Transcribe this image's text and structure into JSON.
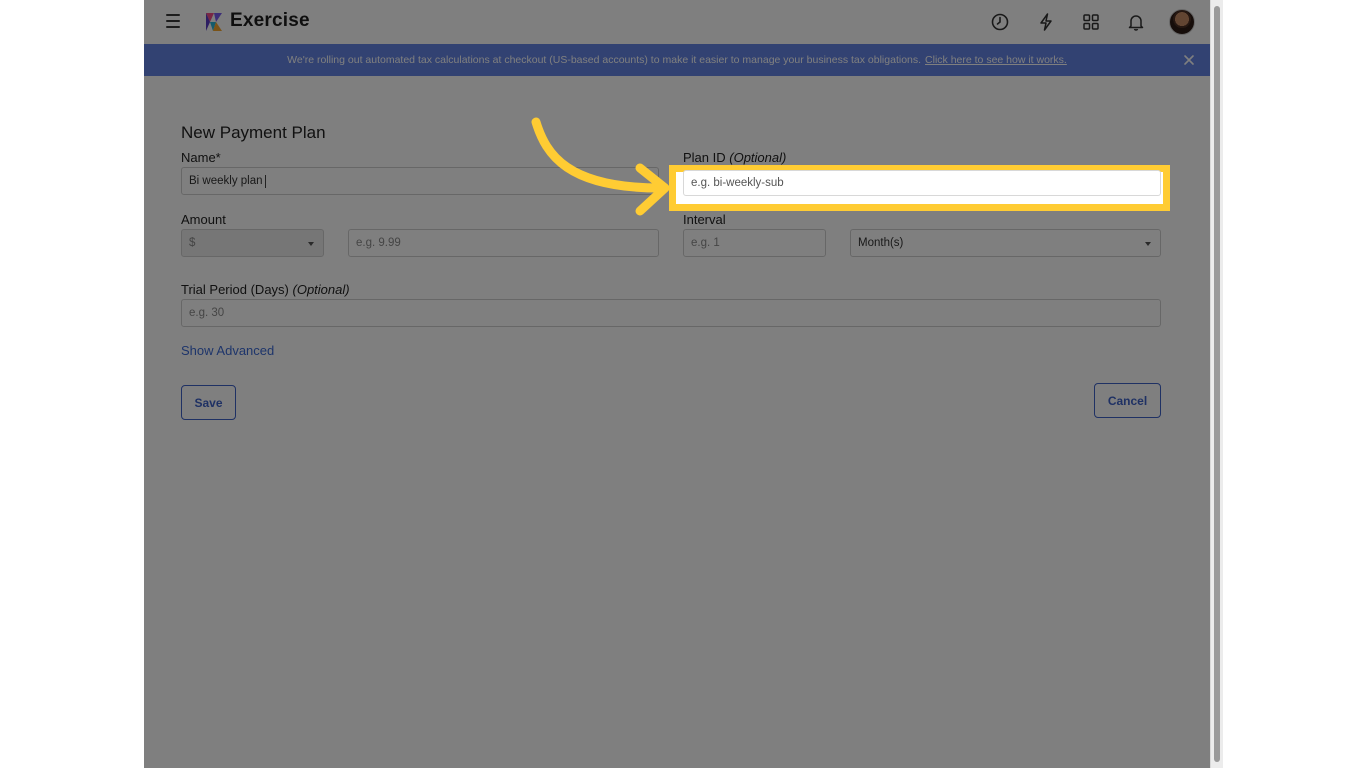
{
  "app": {
    "title": "Exercise"
  },
  "topbar": {
    "icons": [
      "clock-icon",
      "lightning-icon",
      "apps-grid-icon",
      "bell-icon"
    ]
  },
  "banner": {
    "text": "We're rolling out automated tax calculations at checkout (US-based accounts) to make it easier to manage your business tax obligations.",
    "link": "Click here to see how it works."
  },
  "form": {
    "title": "New Payment Plan",
    "name_label": "Name*",
    "name_value": "Bi weekly plan",
    "plan_id_label": "Plan ID",
    "plan_id_optional": "(Optional)",
    "plan_id_placeholder": "e.g. bi-weekly-sub",
    "amount_label": "Amount",
    "currency_value": "$",
    "amount_placeholder": "e.g. 9.99",
    "interval_label": "Interval",
    "interval_placeholder": "e.g. 1",
    "interval_unit_value": "Month(s)",
    "trial_label": "Trial Period (Days)",
    "trial_optional": "(Optional)",
    "trial_placeholder": "e.g. 30",
    "show_advanced": "Show Advanced",
    "save_label": "Save",
    "cancel_label": "Cancel"
  },
  "colors": {
    "banner": "#6584e4",
    "accent": "#3f63c9",
    "highlight": "#ffcc33",
    "overlay": "rgba(0,0,0,0.5)"
  }
}
